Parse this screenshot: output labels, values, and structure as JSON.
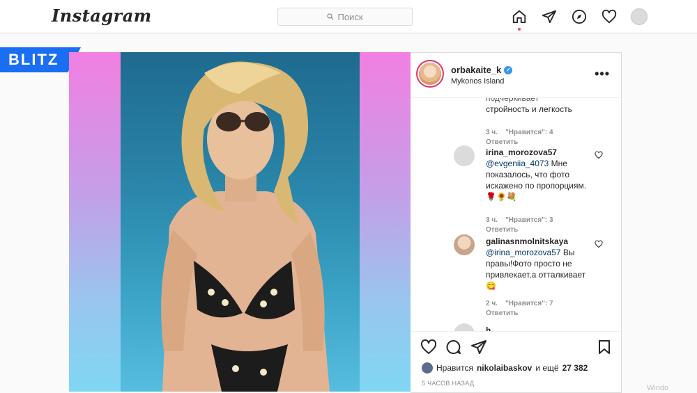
{
  "app": {
    "logo": "Instagram"
  },
  "search": {
    "placeholder": "Поиск"
  },
  "brand_overlay": {
    "text": "BLITZ"
  },
  "post": {
    "username": "orbakaite_k",
    "location": "Mykonos Island",
    "more_label": "•••"
  },
  "comments": [
    {
      "text_line1": "подчеркивает",
      "text_line2": "стройность и легкость",
      "time": "3 ч.",
      "likes": "\"Нравится\": 4",
      "reply": "Ответить"
    },
    {
      "username": "irina_morozova57",
      "mention": "@evgeniia_4073",
      "text": "Мне показалось, что фото искажено по пропорциям.",
      "emoji": "🌹🌻💐",
      "time": "3 ч.",
      "likes": "\"Нравится\": 3",
      "reply": "Ответить"
    },
    {
      "username": "galinasnmolnitskaya",
      "mention": "@irina_morozova57",
      "text": "Вы правы!Фото просто не привлекает,а отталкивает",
      "emoji": "😋",
      "time": "2 ч.",
      "likes": "\"Нравится\": 7",
      "reply": "Ответить"
    },
    {
      "username": "h...",
      "partial": true
    }
  ],
  "actions": {
    "likes_prefix": "Нравится",
    "likes_user": "nikolaibaskov",
    "likes_middle": "и ещё",
    "likes_count": "27 382",
    "time_ago": "5 ЧАСОВ НАЗАД"
  },
  "watermark": "Windo",
  "colors": {
    "accent": "#3897f0",
    "brand_overlay": "#1a6ef2",
    "notification": "#ed4956",
    "secondary_text": "#8e8e8e"
  },
  "icons": {
    "nav": [
      "home-icon",
      "direct-icon",
      "explore-icon",
      "activity-heart-icon",
      "profile-avatar"
    ],
    "actions": [
      "like-heart-icon",
      "comment-icon",
      "share-icon",
      "save-bookmark-icon"
    ]
  }
}
